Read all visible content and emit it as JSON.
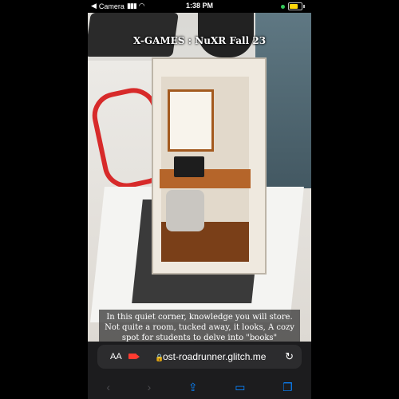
{
  "status_bar": {
    "back_app": "Camera",
    "time": "1:38 PM"
  },
  "scene": {
    "title": "X-GAMES : NuXR Fall 23",
    "caption": "In this quiet corner, knowledge you will store. Not quite a room, tucked away, it looks, A cozy spot for students to delve into \"books\""
  },
  "safari": {
    "text_size_label": "AA",
    "url": "ost-roadrunner.glitch.me"
  },
  "icons": {
    "back": "chevron-left-icon",
    "forward": "chevron-right-icon",
    "share": "share-icon",
    "bookmarks": "book-icon",
    "tabs": "tabs-icon",
    "reload": "reload-icon",
    "camera": "camera-recording-icon",
    "lock": "lock-icon"
  },
  "colors": {
    "accent": "#0a84ff",
    "recording": "#ff3b30",
    "battery": "#ffd60a"
  }
}
